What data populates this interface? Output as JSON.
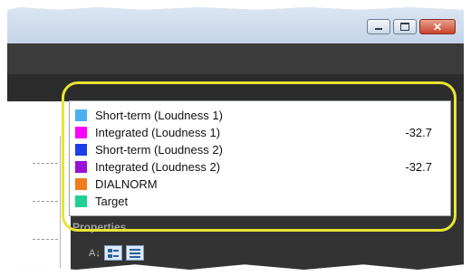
{
  "window": {
    "minimize_icon": "minimize-icon",
    "maximize_icon": "maximize-icon",
    "close_icon": "close-icon",
    "close_glyph": "✕"
  },
  "legend": {
    "items": [
      {
        "label": "Short-term (Loudness 1)",
        "value": "",
        "color": "#4daef0"
      },
      {
        "label": "Integrated (Loudness 1)",
        "value": "-32.7",
        "color": "#ff00ff"
      },
      {
        "label": "Short-term (Loudness 2)",
        "value": "",
        "color": "#1c3ee6"
      },
      {
        "label": "Integrated (Loudness 2)",
        "value": "-32.7",
        "color": "#9b0fd6"
      },
      {
        "label": "DIALNORM",
        "value": "",
        "color": "#f07c1c"
      },
      {
        "label": "Target",
        "value": "",
        "color": "#1fcf96"
      }
    ]
  },
  "properties": {
    "label": "Properties",
    "sort_glyph": "A↓",
    "toolbar_icons": [
      "categorized-icon",
      "list-icon"
    ]
  },
  "colors": {
    "highlight": "#e8e530",
    "dark_panel": "#333333"
  }
}
